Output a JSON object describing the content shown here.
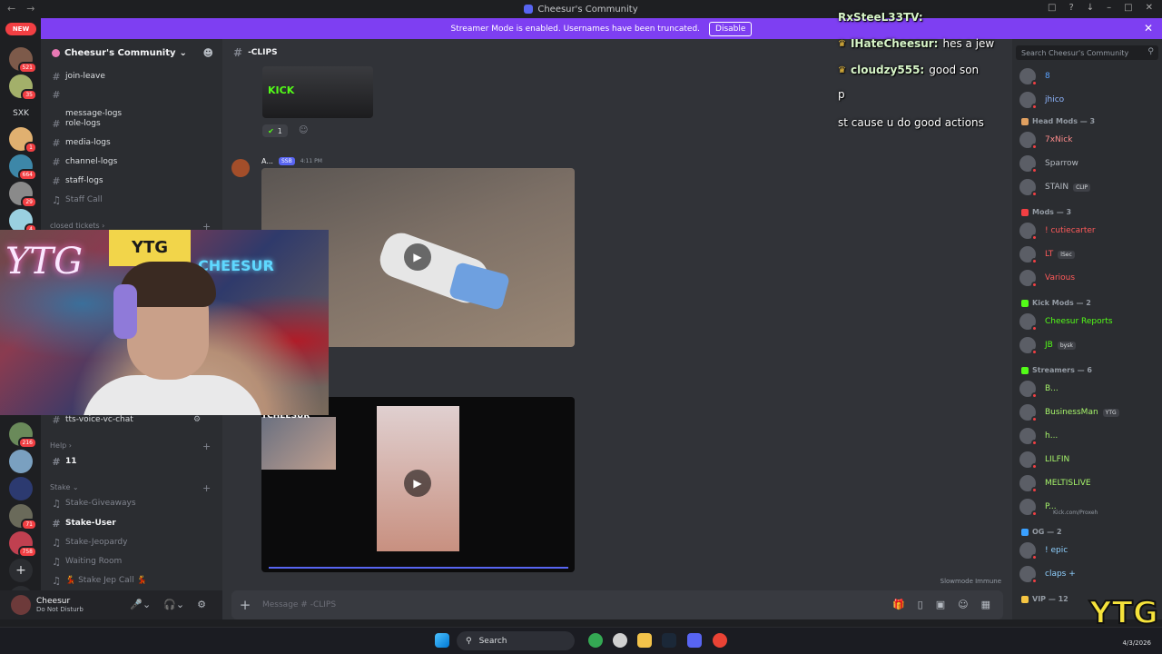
{
  "window": {
    "title": "Cheesur's Community"
  },
  "banner": {
    "text": "Streamer Mode is enabled. Usernames have been truncated.",
    "disable_label": "Disable"
  },
  "rail": {
    "new_label": "NEW",
    "badges": [
      "521",
      "35",
      "1",
      "664",
      "29",
      "4",
      "216",
      "71",
      "758"
    ],
    "text_server": "SXK"
  },
  "server": {
    "name": "Cheesur's Community"
  },
  "channels": [
    {
      "name": "join-leave",
      "type": "text"
    },
    {
      "name": "message-logs",
      "type": "text"
    },
    {
      "name": "role-logs",
      "type": "text"
    },
    {
      "name": "media-logs",
      "type": "text"
    },
    {
      "name": "channel-logs",
      "type": "text"
    },
    {
      "name": "staff-logs",
      "type": "text"
    },
    {
      "name": "Staff Call",
      "type": "voice"
    }
  ],
  "categories": {
    "closed_tickets": "closed tickets",
    "help": "Help",
    "stake": "Stake"
  },
  "channels_lower": [
    {
      "name": "tts-voice-vc-chat"
    },
    {
      "name": "11"
    },
    {
      "name": "Stake-Giveaways"
    },
    {
      "name": "Stake-User"
    },
    {
      "name": "Stake-Jeopardy"
    },
    {
      "name": "Waiting Room"
    },
    {
      "name": "💃 Stake Jep Call 💃"
    }
  ],
  "user": {
    "name": "Cheesur",
    "status": "Do Not Disturb"
  },
  "chat": {
    "channel": "-CLIPS",
    "author": "A...",
    "author_tag": "SSB",
    "time": "4:11 PM",
    "reaction_count": "1",
    "slowmode": "Slowmode Immune",
    "placeholder": "Message # -CLIPS",
    "kick_label": "KICK",
    "video_label": "TCHEESUR"
  },
  "overlay": [
    {
      "user": "RxSteeL33TV:",
      "text": ""
    },
    {
      "user": "IHateCheesur:",
      "text": "hes a jew"
    },
    {
      "user": "cloudzy555:",
      "text": "good son"
    },
    {
      "user": "",
      "text": "p"
    },
    {
      "user": "",
      "text": "st cause u do good actions"
    }
  ],
  "members": {
    "search_placeholder": "Search Cheesur's Community",
    "top": [
      {
        "name": "8",
        "color": "#5aa2ff"
      },
      {
        "name": "jhico",
        "color": "#8fb6ff"
      }
    ],
    "groups": [
      {
        "title": "Head Mods — 3",
        "color": "#e0a060",
        "items": [
          {
            "name": "7xNick",
            "color": "#ff8c8c",
            "chip": ""
          },
          {
            "name": "Sparrow",
            "color": "#b5bac1",
            "chip": ""
          },
          {
            "name": "STAIN",
            "color": "#b5bac1",
            "chip": "CLIP"
          }
        ]
      },
      {
        "title": "Mods — 3",
        "color": "#f23f43",
        "items": [
          {
            "name": "! cutiecarter",
            "color": "#ff5a5a",
            "chip": ""
          },
          {
            "name": "LT",
            "color": "#ff5a5a",
            "chip": "lSec"
          },
          {
            "name": "Various",
            "color": "#ff5a5a",
            "chip": ""
          }
        ]
      },
      {
        "title": "Kick Mods — 2",
        "color": "#53fc18",
        "items": [
          {
            "name": "Cheesur Reports",
            "color": "#53fc18",
            "chip": ""
          },
          {
            "name": "JB",
            "color": "#53fc18",
            "chip": "bysk"
          }
        ]
      },
      {
        "title": "Streamers — 6",
        "color": "#53fc18",
        "items": [
          {
            "name": "B...",
            "color": "#a6f36a",
            "chip": ""
          },
          {
            "name": "BusinessMan",
            "color": "#a6f36a",
            "chip": "YTG"
          },
          {
            "name": "h...",
            "color": "#a6f36a",
            "chip": ""
          },
          {
            "name": "LILFIN",
            "color": "#a6f36a",
            "chip": ""
          },
          {
            "name": "MELTISLIVE",
            "color": "#a6f36a",
            "chip": ""
          },
          {
            "name": "P...",
            "color": "#a6f36a",
            "chip": "",
            "sub": "Kick.com/Proxeh"
          }
        ]
      },
      {
        "title": "OG — 2",
        "color": "#3aa0ff",
        "items": [
          {
            "name": "! epic",
            "color": "#8fd0ff",
            "chip": ""
          },
          {
            "name": "claps +",
            "color": "#8fd0ff",
            "chip": ""
          }
        ]
      },
      {
        "title": "VIP — 12",
        "color": "#f5c542",
        "items": []
      }
    ]
  },
  "taskbar": {
    "search_label": "Search",
    "time": "4/3/2026"
  },
  "watermark": "YTG",
  "webcam": {
    "ytg": "YTG",
    "sign": "YTG",
    "neon": "CHEESUR"
  }
}
